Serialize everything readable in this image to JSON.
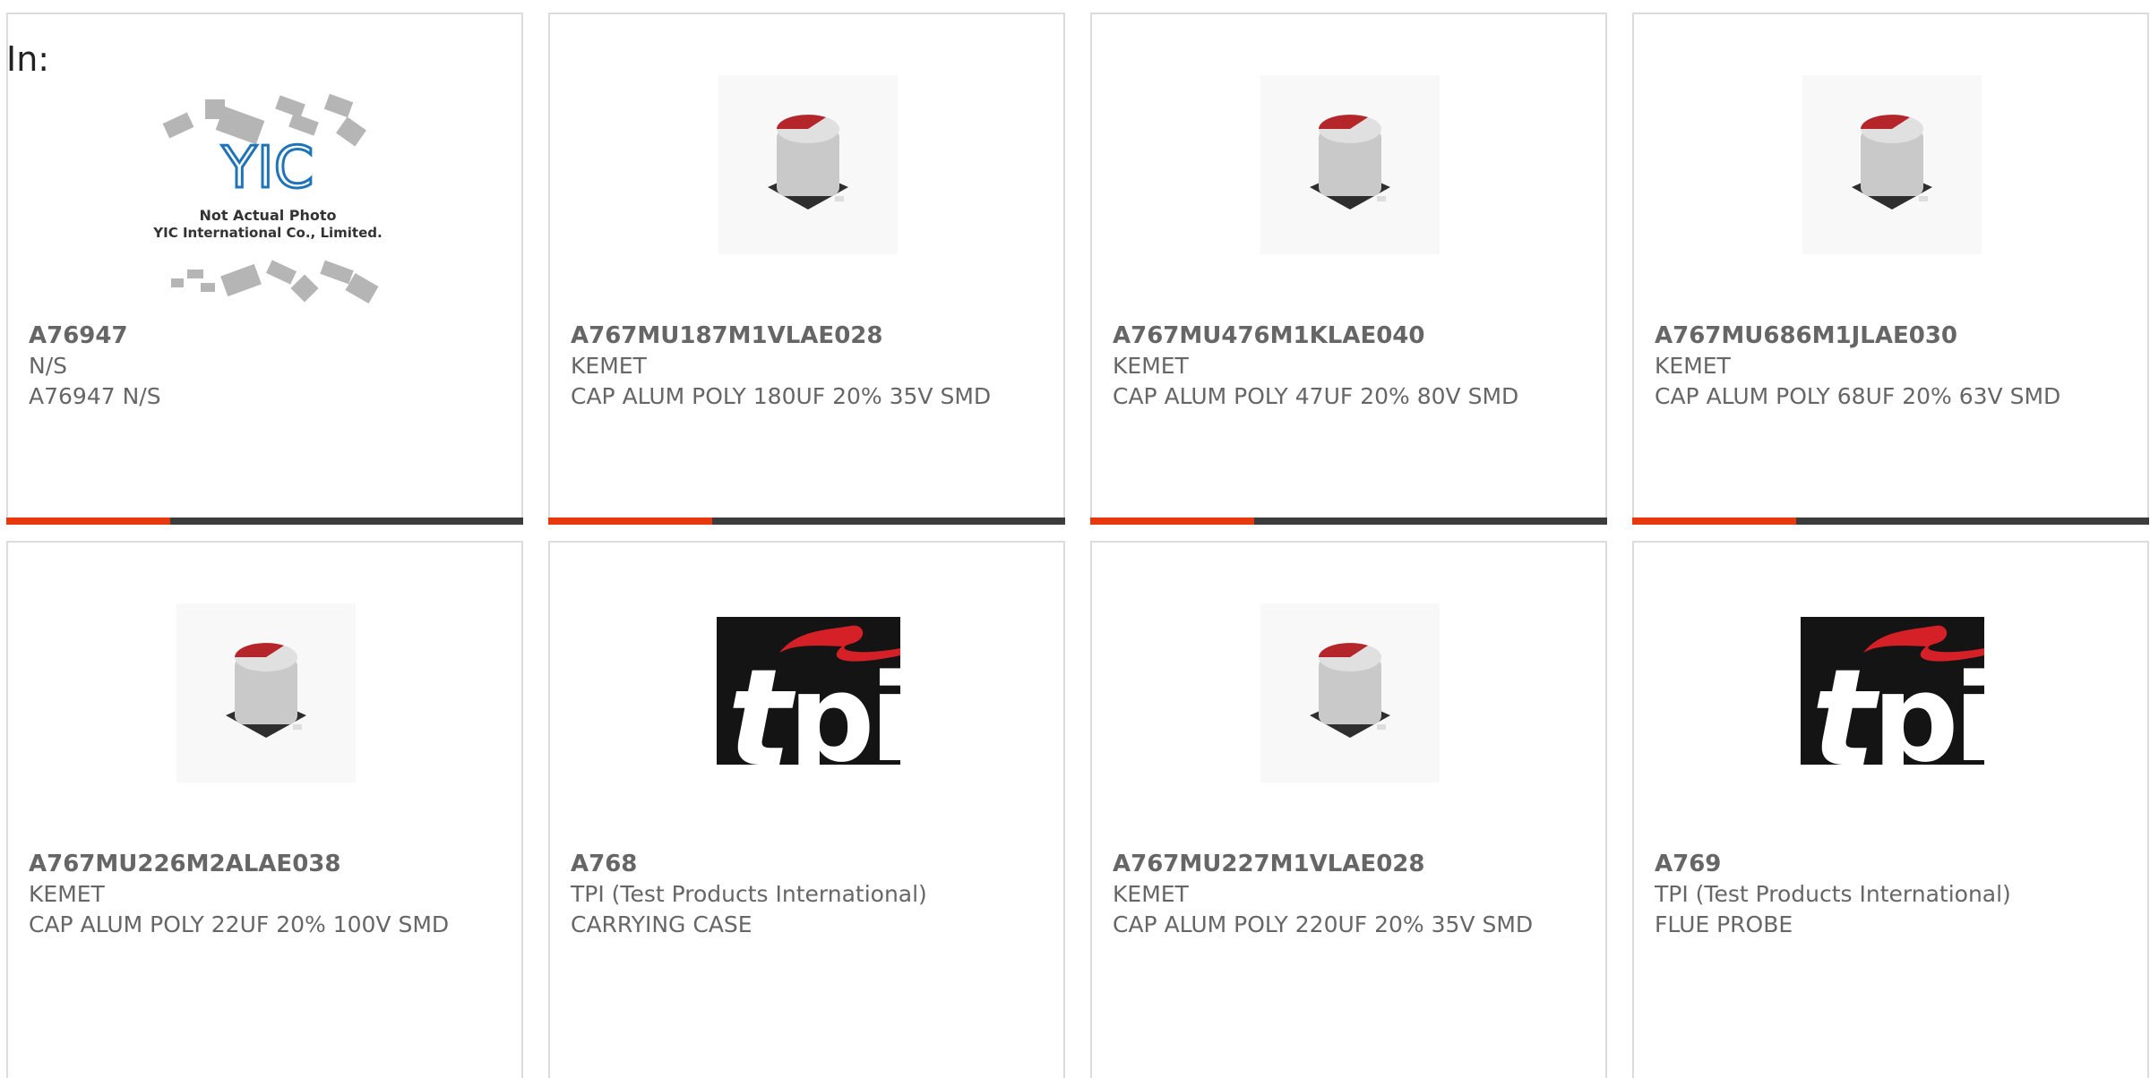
{
  "filter": {
    "label": "In:"
  },
  "placeholder_logo": {
    "note1": "Not Actual Photo",
    "note2": "YIC International Co., Limited.",
    "brand": "YIC"
  },
  "accent_color": "#e8380d",
  "bar_color": "#3c3c3c",
  "products": [
    {
      "part": "A76947",
      "manufacturer": "N/S",
      "desc": "A76947 N/S",
      "image": "placeholder-logo"
    },
    {
      "part": "A767MU187M1VLAE028",
      "manufacturer": "KEMET",
      "desc": "CAP ALUM POLY 180UF 20% 35V SMD",
      "image": "capacitor-photo"
    },
    {
      "part": "A767MU476M1KLAE040",
      "manufacturer": "KEMET",
      "desc": "CAP ALUM POLY 47UF 20% 80V SMD",
      "image": "capacitor-photo"
    },
    {
      "part": "A767MU686M1JLAE030",
      "manufacturer": "KEMET",
      "desc": "CAP ALUM POLY 68UF 20% 63V SMD",
      "image": "capacitor-photo"
    },
    {
      "part": "A767MU226M2ALAE038",
      "manufacturer": "KEMET",
      "desc": "CAP ALUM POLY 22UF 20% 100V SMD",
      "image": "capacitor-photo"
    },
    {
      "part": "A768",
      "manufacturer": "TPI (Test Products International)",
      "desc": "CARRYING CASE",
      "image": "tpi-logo"
    },
    {
      "part": "A767MU227M1VLAE028",
      "manufacturer": "KEMET",
      "desc": "CAP ALUM POLY 220UF 20% 35V SMD",
      "image": "capacitor-photo"
    },
    {
      "part": "A769",
      "manufacturer": "TPI (Test Products International)",
      "desc": "FLUE PROBE",
      "image": "tpi-logo"
    }
  ]
}
